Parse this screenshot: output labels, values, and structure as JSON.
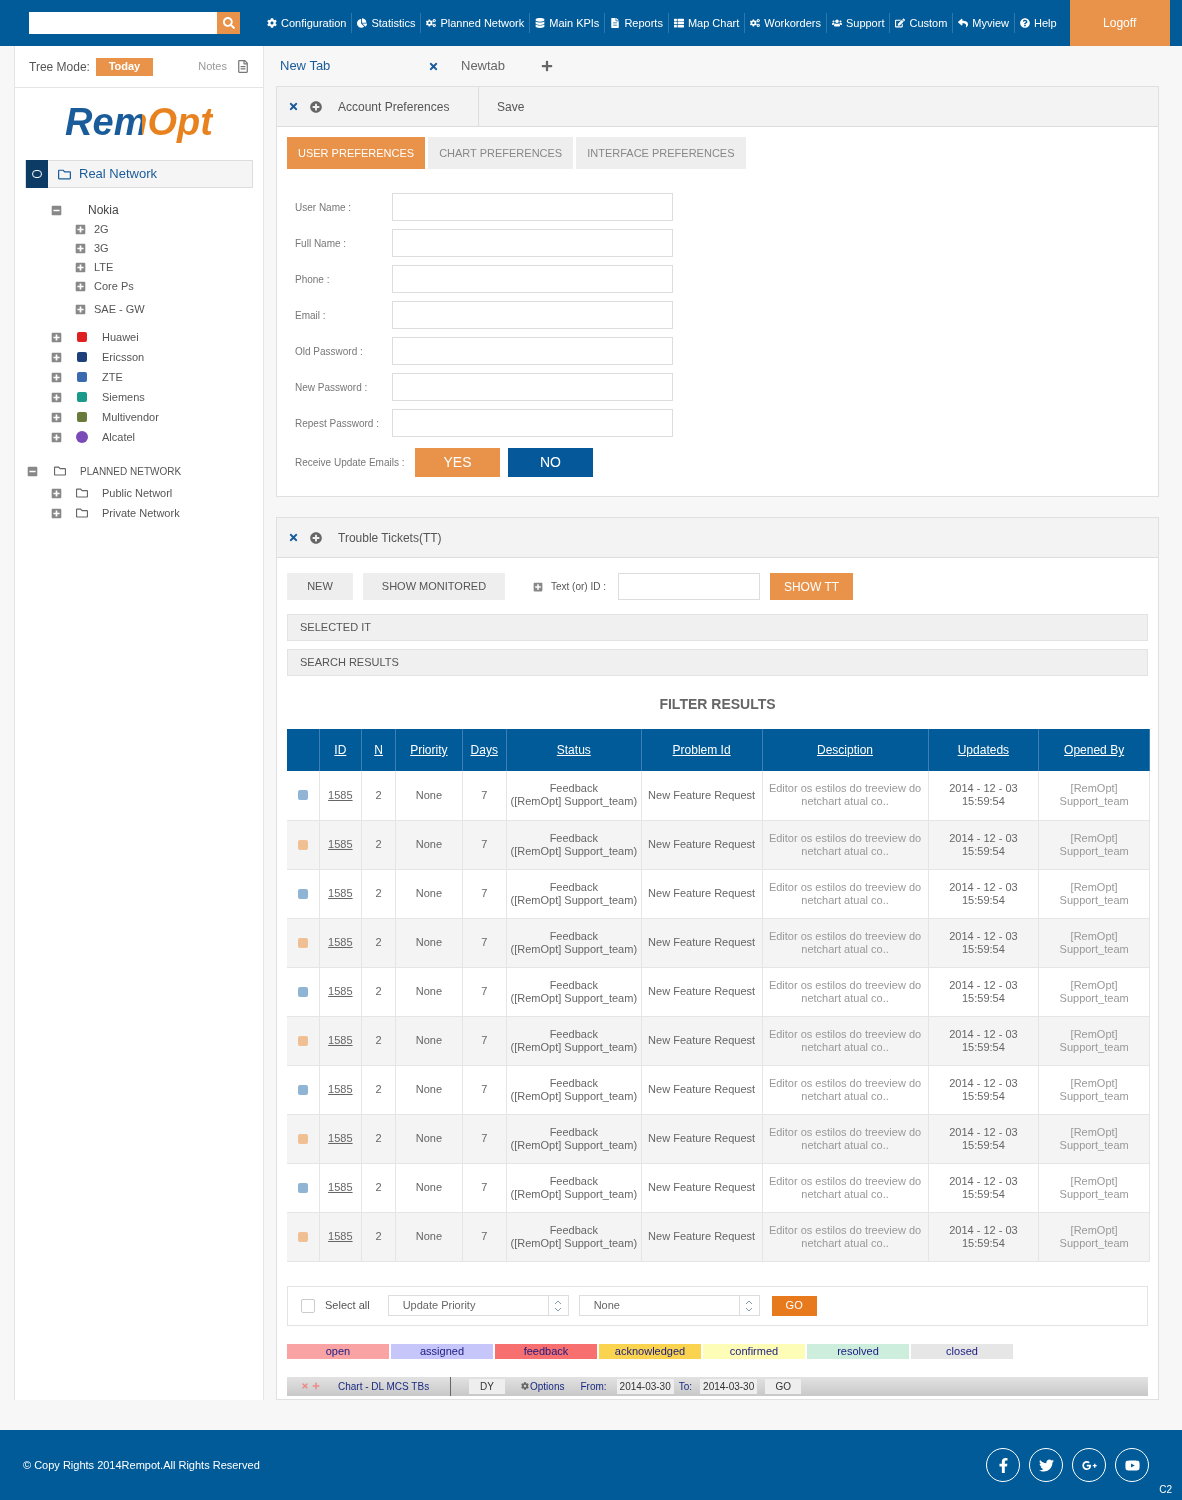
{
  "nav": {
    "items": [
      "Configuration",
      "Statistics",
      "Planned Network",
      "Main KPIs",
      "Reports",
      "Map Chart",
      "Workorders",
      "Support",
      "Custom",
      "Myview",
      "Help"
    ],
    "logoff": "Logoff"
  },
  "sidebar": {
    "tree_mode_label": "Tree Mode:",
    "tree_mode_value": "Today",
    "notes": "Notes",
    "logo": "RemOpt",
    "tree": [
      {
        "label": "Real Network",
        "kind": "root",
        "expanded": true,
        "children": [
          {
            "label": "Nokia",
            "kind": "vendor",
            "expanded": true,
            "children": [
              {
                "label": "2G",
                "expanded": false
              },
              {
                "label": "3G",
                "expanded": false
              },
              {
                "label": "LTE",
                "expanded": false
              },
              {
                "label": "Core Ps",
                "expanded": false
              },
              {
                "label": "SAE - GW",
                "expanded": false
              }
            ]
          },
          {
            "label": "Huawei",
            "kind": "vendor",
            "expanded": false
          },
          {
            "label": "Ericsson",
            "kind": "vendor",
            "expanded": false
          },
          {
            "label": "ZTE",
            "kind": "vendor",
            "expanded": false
          },
          {
            "label": "Siemens",
            "kind": "vendor",
            "expanded": false
          },
          {
            "label": "Multivendor",
            "kind": "vendor",
            "expanded": false
          },
          {
            "label": "Alcatel",
            "kind": "vendor",
            "expanded": false
          }
        ]
      },
      {
        "label": "PLANNED NETWORK",
        "kind": "section",
        "expanded": true,
        "children": [
          {
            "label": "Public Networl",
            "kind": "folder",
            "expanded": false
          },
          {
            "label": "Private Network",
            "kind": "folder",
            "expanded": false
          }
        ]
      }
    ]
  },
  "tabs": [
    {
      "label": "New Tab",
      "selected": true
    },
    {
      "label": "Newtab",
      "selected": false
    }
  ],
  "account": {
    "title": "Account Preferences",
    "save": "Save",
    "tabs": [
      {
        "label": "USER PREFERENCES",
        "selected": true
      },
      {
        "label": "CHART PREFERENCES",
        "selected": false
      },
      {
        "label": "INTERFACE PREFERENCES",
        "selected": false
      }
    ],
    "fields": [
      "User Name :",
      "Full Name :",
      "Phone :",
      "Email :",
      "Old Password :",
      "New Password :",
      "Repest Password :"
    ],
    "emails_label": "Receive Update Emails :",
    "emails_options": [
      {
        "label": "YES",
        "selected": true
      },
      {
        "label": "NO",
        "selected": false
      }
    ]
  },
  "tickets": {
    "title": "Trouble Tickets(TT)",
    "new": "NEW",
    "show_monitored": "SHOW MONITORED",
    "search_label": "Text (or) ID :",
    "show_tt": "SHOW TT",
    "selected_it": "SELECTED IT",
    "search_results": "SEARCH RESULTS",
    "filter_title": "FILTER RESULTS",
    "columns": [
      "ID",
      "N",
      "Priority",
      "Days",
      "Status",
      "Problem Id",
      "Desciption",
      "Updateds",
      "Opened By"
    ],
    "rows": [
      {
        "color": "#8fb4d4",
        "id": "1585",
        "n": "2",
        "priority": "None",
        "days": "7",
        "status": [
          "Feedback",
          "([RemOpt] Support_team)"
        ],
        "problem": "New Feature Request",
        "description": [
          "Editor os estilos do treeview do",
          "netchart atual co.."
        ],
        "updated": [
          "2014 - 12 - 03",
          "15:59:54"
        ],
        "opened_by": [
          "[RemOpt]",
          "Support_team"
        ]
      },
      {
        "color": "#f0bf94",
        "id": "1585",
        "n": "2",
        "priority": "None",
        "days": "7",
        "status": [
          "Feedback",
          "([RemOpt] Support_team)"
        ],
        "problem": "New Feature Request",
        "description": [
          "Editor os estilos do treeview do",
          "netchart atual co.."
        ],
        "updated": [
          "2014 - 12 - 03",
          "15:59:54"
        ],
        "opened_by": [
          "[RemOpt]",
          "Support_team"
        ]
      },
      {
        "color": "#8fb4d4",
        "id": "1585",
        "n": "2",
        "priority": "None",
        "days": "7",
        "status": [
          "Feedback",
          "([RemOpt] Support_team)"
        ],
        "problem": "New Feature Request",
        "description": [
          "Editor os estilos do treeview do",
          "netchart atual co.."
        ],
        "updated": [
          "2014 - 12 - 03",
          "15:59:54"
        ],
        "opened_by": [
          "[RemOpt]",
          "Support_team"
        ]
      },
      {
        "color": "#f0bf94",
        "id": "1585",
        "n": "2",
        "priority": "None",
        "days": "7",
        "status": [
          "Feedback",
          "([RemOpt] Support_team)"
        ],
        "problem": "New Feature Request",
        "description": [
          "Editor os estilos do treeview do",
          "netchart atual co.."
        ],
        "updated": [
          "2014 - 12 - 03",
          "15:59:54"
        ],
        "opened_by": [
          "[RemOpt]",
          "Support_team"
        ]
      },
      {
        "color": "#8fb4d4",
        "id": "1585",
        "n": "2",
        "priority": "None",
        "days": "7",
        "status": [
          "Feedback",
          "([RemOpt] Support_team)"
        ],
        "problem": "New Feature Request",
        "description": [
          "Editor os estilos do treeview do",
          "netchart atual co.."
        ],
        "updated": [
          "2014 - 12 - 03",
          "15:59:54"
        ],
        "opened_by": [
          "[RemOpt]",
          "Support_team"
        ]
      },
      {
        "color": "#f0bf94",
        "id": "1585",
        "n": "2",
        "priority": "None",
        "days": "7",
        "status": [
          "Feedback",
          "([RemOpt] Support_team)"
        ],
        "problem": "New Feature Request",
        "description": [
          "Editor os estilos do treeview do",
          "netchart atual co.."
        ],
        "updated": [
          "2014 - 12 - 03",
          "15:59:54"
        ],
        "opened_by": [
          "[RemOpt]",
          "Support_team"
        ]
      },
      {
        "color": "#8fb4d4",
        "id": "1585",
        "n": "2",
        "priority": "None",
        "days": "7",
        "status": [
          "Feedback",
          "([RemOpt] Support_team)"
        ],
        "problem": "New Feature Request",
        "description": [
          "Editor os estilos do treeview do",
          "netchart atual co.."
        ],
        "updated": [
          "2014 - 12 - 03",
          "15:59:54"
        ],
        "opened_by": [
          "[RemOpt]",
          "Support_team"
        ]
      },
      {
        "color": "#f0bf94",
        "id": "1585",
        "n": "2",
        "priority": "None",
        "days": "7",
        "status": [
          "Feedback",
          "([RemOpt] Support_team)"
        ],
        "problem": "New Feature Request",
        "description": [
          "Editor os estilos do treeview do",
          "netchart atual co.."
        ],
        "updated": [
          "2014 - 12 - 03",
          "15:59:54"
        ],
        "opened_by": [
          "[RemOpt]",
          "Support_team"
        ]
      },
      {
        "color": "#8fb4d4",
        "id": "1585",
        "n": "2",
        "priority": "None",
        "days": "7",
        "status": [
          "Feedback",
          "([RemOpt] Support_team)"
        ],
        "problem": "New Feature Request",
        "description": [
          "Editor os estilos do treeview do",
          "netchart atual co.."
        ],
        "updated": [
          "2014 - 12 - 03",
          "15:59:54"
        ],
        "opened_by": [
          "[RemOpt]",
          "Support_team"
        ]
      },
      {
        "color": "#f0bf94",
        "id": "1585",
        "n": "2",
        "priority": "None",
        "days": "7",
        "status": [
          "Feedback",
          "([RemOpt] Support_team)"
        ],
        "problem": "New Feature Request",
        "description": [
          "Editor os estilos do treeview do",
          "netchart atual co.."
        ],
        "updated": [
          "2014 - 12 - 03",
          "15:59:54"
        ],
        "opened_by": [
          "[RemOpt]",
          "Support_team"
        ]
      }
    ],
    "select_all": {
      "label": "Select all",
      "checked": false
    },
    "update_priority": "Update Priority",
    "priority_value": "None",
    "go": "GO",
    "legend": [
      {
        "label": "open",
        "color": "#f9a3a5"
      },
      {
        "label": "assigned",
        "color": "#c6c6fa"
      },
      {
        "label": "feedback",
        "color": "#f76f6f"
      },
      {
        "label": "acknowledged",
        "color": "#fbd44f"
      },
      {
        "label": "confirmed",
        "color": "#fdfdb8"
      },
      {
        "label": "resolved",
        "color": "#cdeedd"
      },
      {
        "label": "closed",
        "color": "#e6e6e6"
      }
    ],
    "chart_bar": {
      "title": "Chart - DL MCS TBs",
      "dy": "DY",
      "options": "Options",
      "from_label": "From:",
      "from": "2014-03-30",
      "to_label": "To:",
      "to": "2014-03-30",
      "go": "GO"
    }
  },
  "footer": {
    "copyright": "© Copy Rights 2014Rempot.All Rights Reserved",
    "corner": "C2"
  }
}
